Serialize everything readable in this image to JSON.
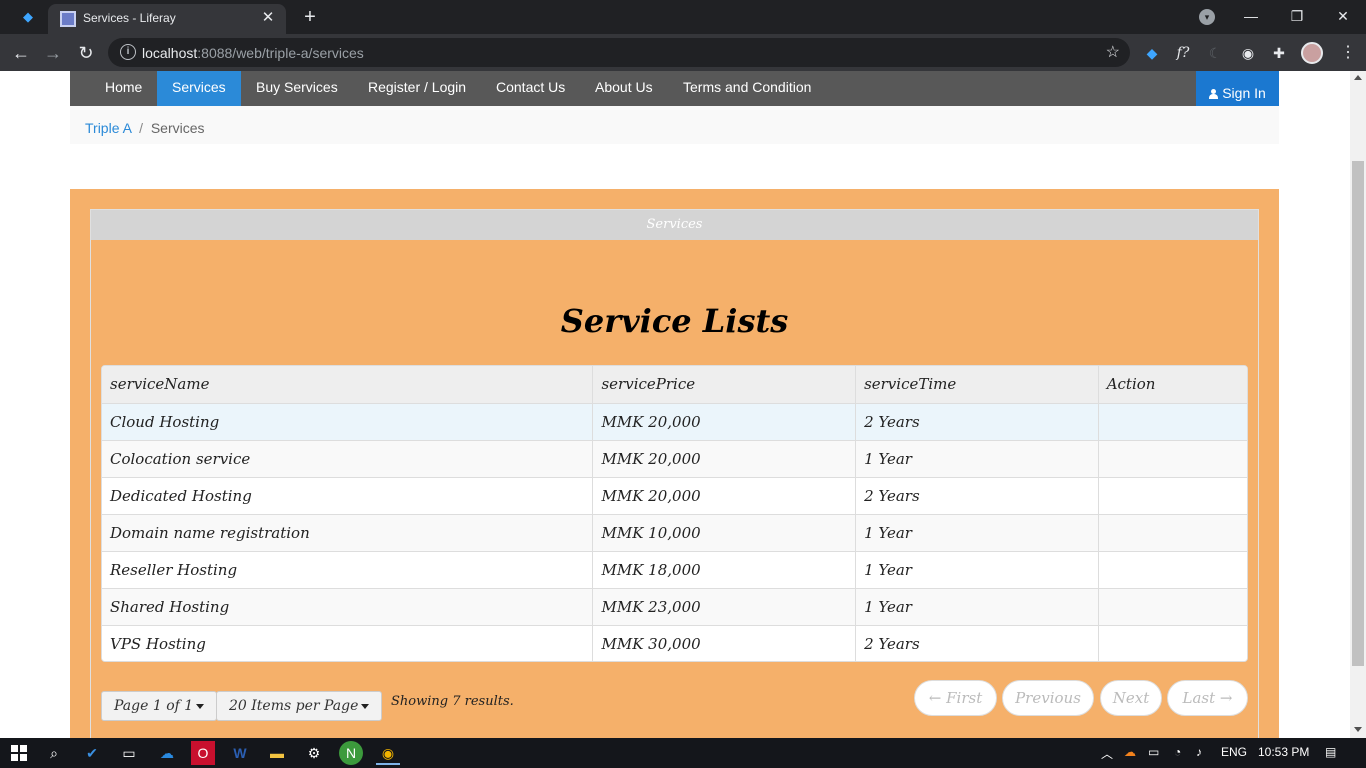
{
  "browser": {
    "tab_title": "Services - Liferay",
    "url_host": "localhost",
    "url_rest": ":8088/web/triple-a/services",
    "ext_f": "f?"
  },
  "nav": {
    "items": [
      {
        "label": "Home"
      },
      {
        "label": "Services"
      },
      {
        "label": "Buy Services"
      },
      {
        "label": "Register / Login"
      },
      {
        "label": "Contact Us"
      },
      {
        "label": "About Us"
      },
      {
        "label": "Terms and Condition"
      }
    ],
    "active_index": 1,
    "sign_in": "Sign In"
  },
  "breadcrumb": {
    "home": "Triple A",
    "separator": "/",
    "current": "Services"
  },
  "portlet": {
    "header": "Services",
    "title": "Service Lists"
  },
  "table": {
    "columns": [
      "serviceName",
      "servicePrice",
      "serviceTime",
      "Action"
    ],
    "rows": [
      [
        "Cloud Hosting",
        "MMK 20,000",
        "2 Years",
        ""
      ],
      [
        "Colocation service",
        "MMK 20,000",
        "1 Year",
        ""
      ],
      [
        "Dedicated Hosting",
        "MMK 20,000",
        "2 Years",
        ""
      ],
      [
        "Domain name registration",
        "MMK 10,000",
        "1 Year",
        ""
      ],
      [
        "Reseller Hosting",
        "MMK 18,000",
        "1 Year",
        ""
      ],
      [
        "Shared Hosting",
        "MMK 23,000",
        "1 Year",
        ""
      ],
      [
        "VPS Hosting",
        "MMK 30,000",
        "2 Years",
        ""
      ]
    ]
  },
  "pagination": {
    "page_label": "Page 1 of 1",
    "per_page_label": "20 Items per Page",
    "showing": "Showing 7 results.",
    "first": "← First",
    "previous": "Previous",
    "next": "Next",
    "last": "Last →"
  },
  "taskbar": {
    "language": "ENG",
    "time": "10:53 PM"
  },
  "colors": {
    "nav_bg": "#585858",
    "nav_active": "#2b8ad8",
    "sign_in_bg": "#1b78d0",
    "panel_bg": "#f5b06a"
  }
}
